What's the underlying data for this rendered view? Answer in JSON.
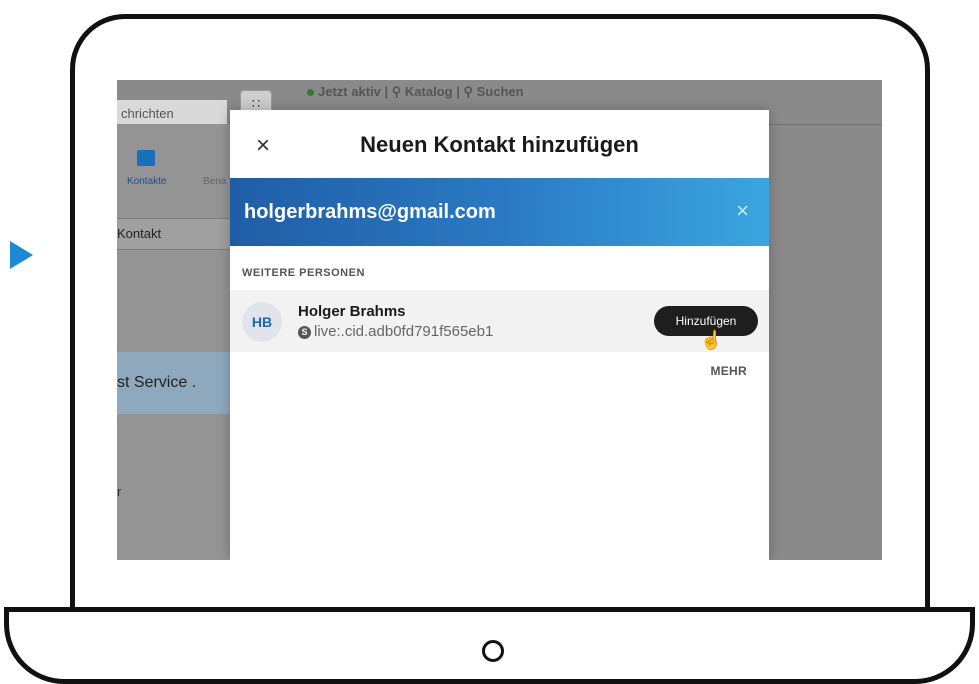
{
  "background": {
    "search_partial": "chrichten",
    "grid_icon": "grid-icon",
    "top_status": "Jetzt aktiv",
    "top_sep1": "|",
    "top_catalog": "Katalog",
    "top_sep2": "|",
    "top_search": "Suchen",
    "sidebar_contacts_label": "Kontakte",
    "sidebar_bena_label": "Bena",
    "kontakt_row_label": "Kontakt",
    "service_row_label": "st Service .",
    "small_mark": "r"
  },
  "dialog": {
    "close_glyph": "×",
    "title": "Neuen Kontakt hinzufügen",
    "search_value": "holgerbrahms@gmail.com",
    "clear_glyph": "×",
    "section_header": "WEITERE PERSONEN",
    "result": {
      "initials": "HB",
      "name": "Holger Brahms",
      "skype_badge": "S",
      "id": "live:.cid.adb0fd791f565eb1",
      "add_label": "Hinzufügen"
    },
    "more_label": "MEHR"
  },
  "colors": {
    "accent_blue": "#1f5ea6",
    "arrow_blue": "#1b8ad6",
    "add_button_bg": "#1e1e1e"
  }
}
